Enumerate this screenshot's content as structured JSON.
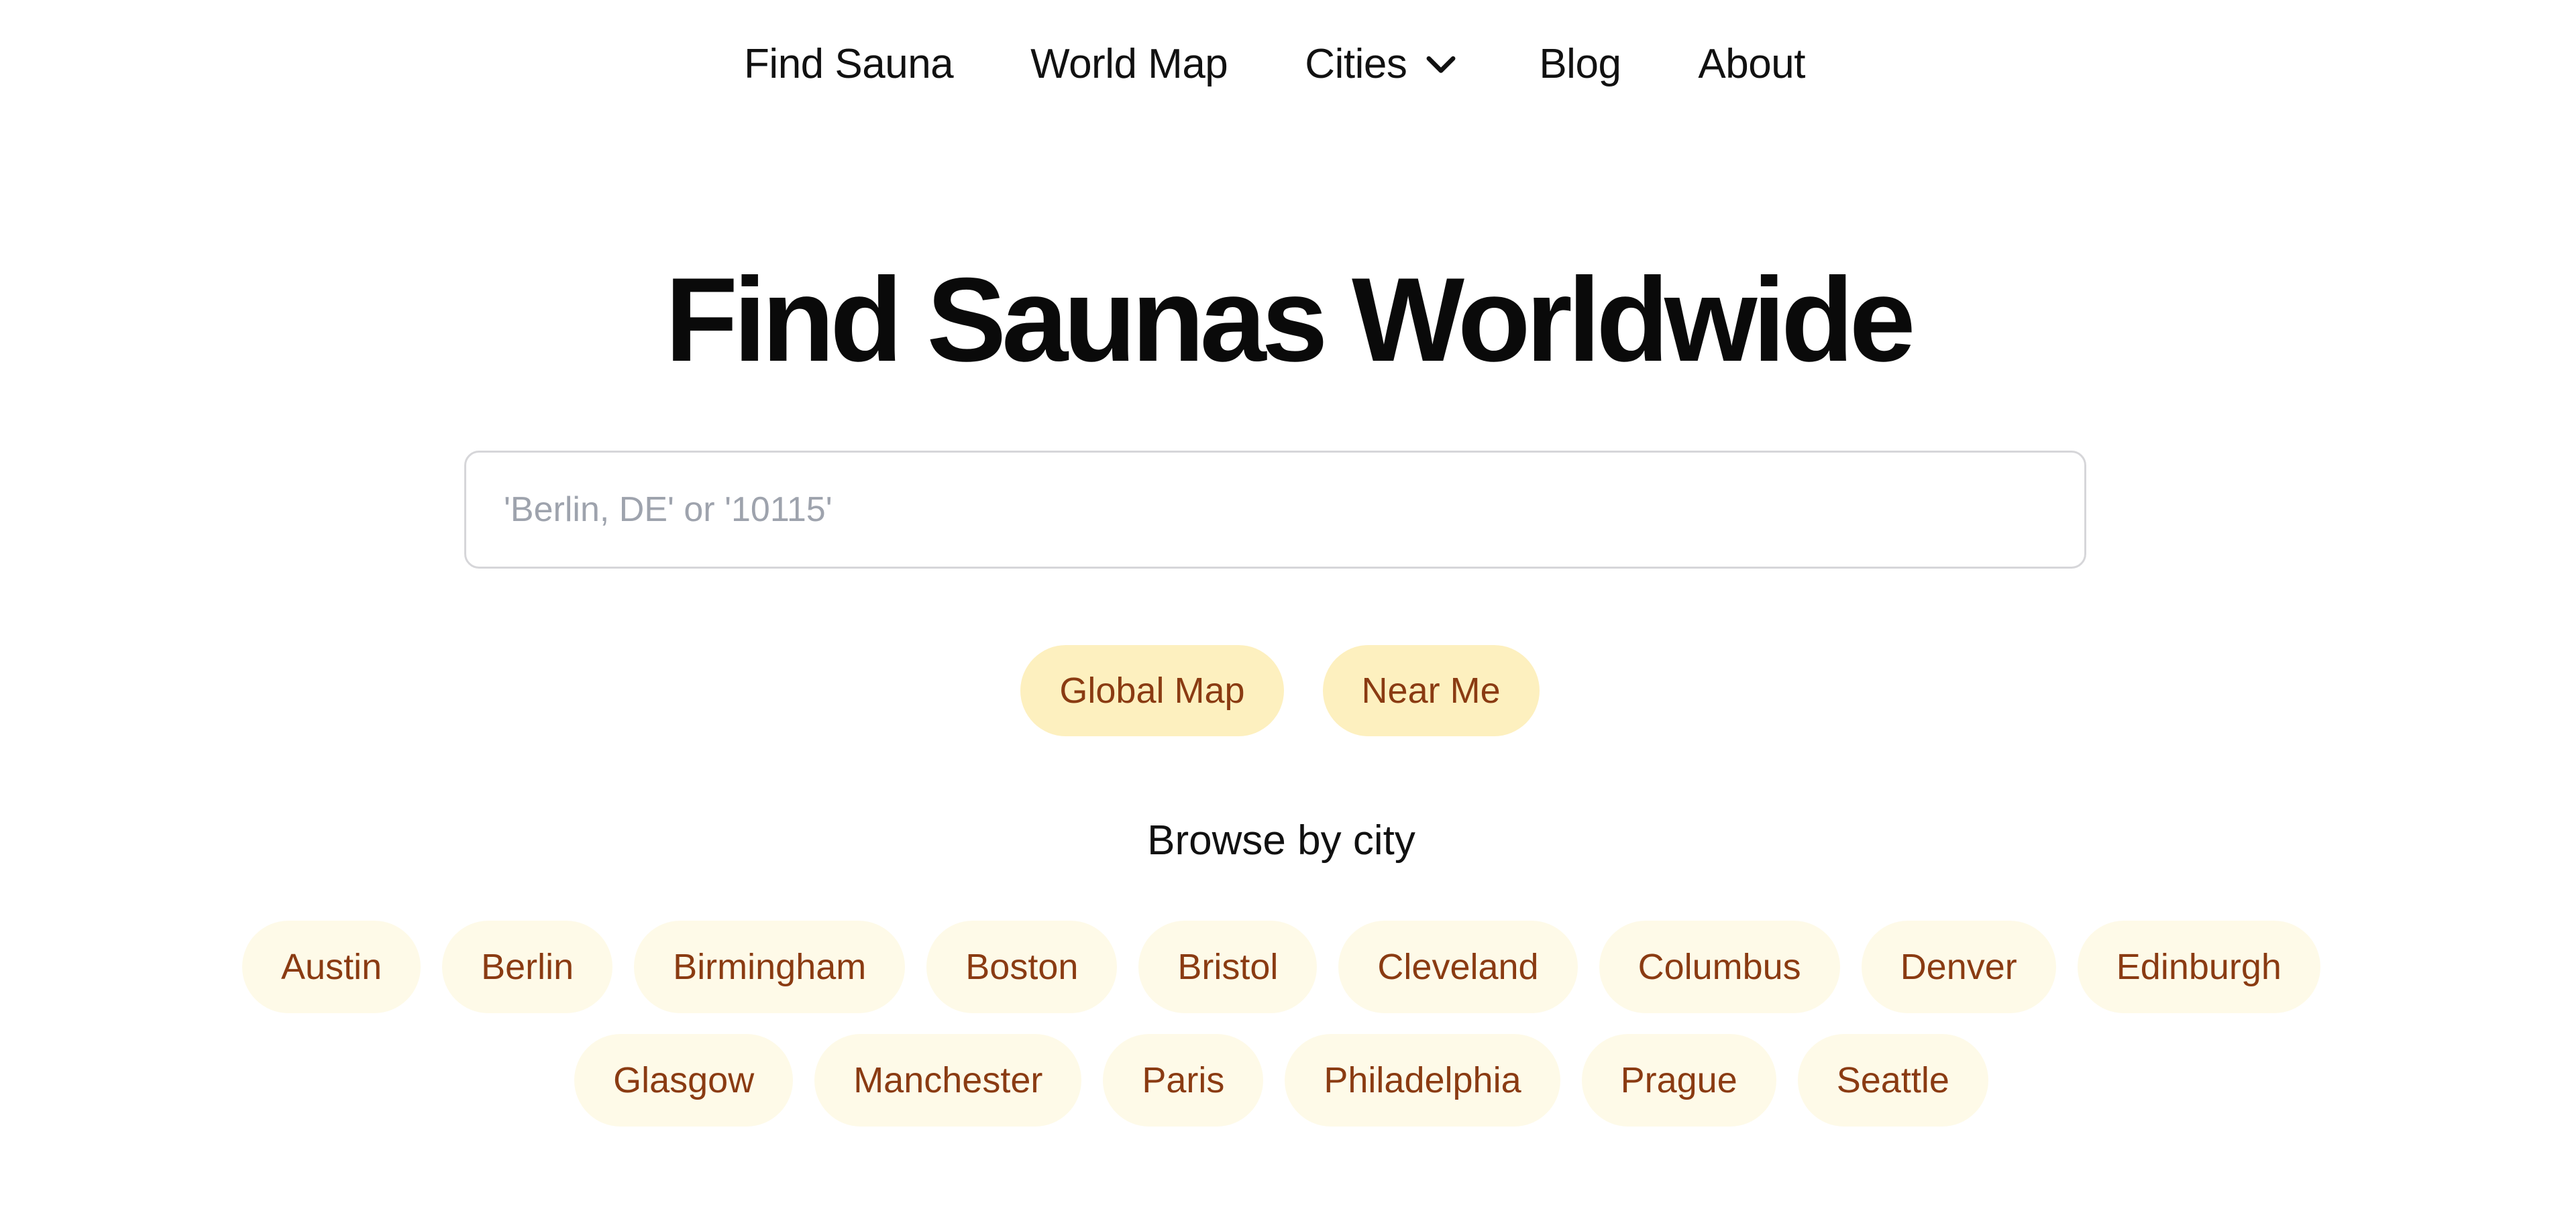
{
  "nav": {
    "items": [
      {
        "label": "Find Sauna"
      },
      {
        "label": "World Map"
      },
      {
        "label": "Cities",
        "icon": "chevron-down-icon"
      },
      {
        "label": "Blog"
      },
      {
        "label": "About"
      }
    ]
  },
  "hero": {
    "title": "Find Saunas Worldwide"
  },
  "search": {
    "value": "",
    "placeholder": "'Berlin, DE' or '10115'"
  },
  "actions": {
    "global_map": "Global Map",
    "near_me": "Near Me"
  },
  "browse": {
    "heading": "Browse by city",
    "cities_row1": [
      "Austin",
      "Berlin",
      "Birmingham",
      "Boston",
      "Bristol",
      "Cleveland",
      "Columbus",
      "Denver",
      "Edinburgh"
    ],
    "cities_row2": [
      "Glasgow",
      "Manchester",
      "Paris",
      "Philadelphia",
      "Prague",
      "Seattle"
    ]
  },
  "colors": {
    "action_bg": "#fdf0bf",
    "chip_bg": "#fefae8",
    "accent_text": "#8a3b12",
    "placeholder": "#9ea3ad",
    "input_border": "#d6d6d9"
  }
}
